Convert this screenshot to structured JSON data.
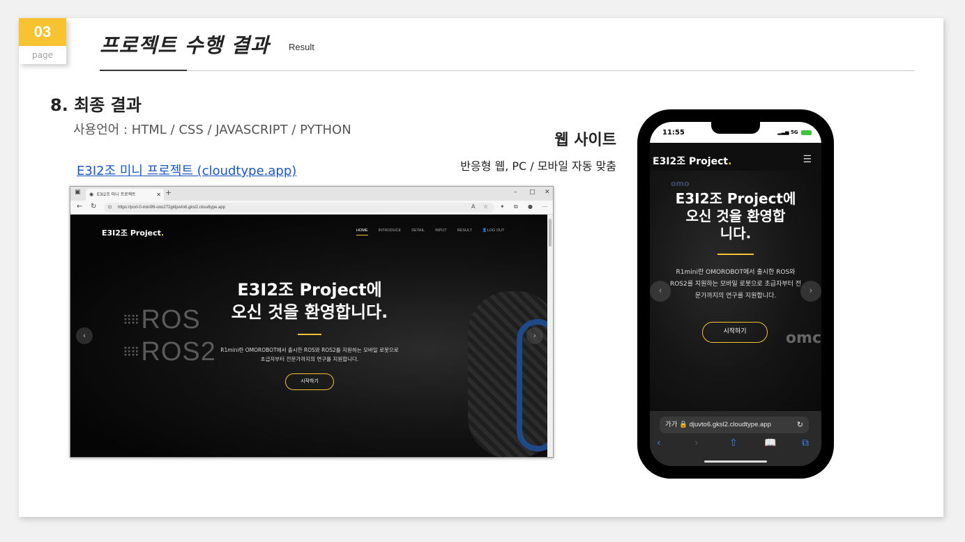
{
  "badge": {
    "number": "03",
    "label": "page"
  },
  "header": {
    "title": "프로젝트 수행 결과",
    "subtitle": "Result"
  },
  "section": {
    "title": "8. 최종 결과",
    "languages": "사용언어 : HTML / CSS / JAVASCRIPT / PYTHON",
    "link": "E3I2조 미니 프로젝트 (cloudtype.app)",
    "web_title": "웹 사이트",
    "web_desc": "반응형 웹, PC / 모바일 자동 맞춤"
  },
  "browser": {
    "tab_title": "E3I2조 미니 프로젝트",
    "url": "https://port-0-mini99-ooo272gldjuvto6.gksl2.cloudtype.app",
    "controls": [
      "–",
      "□",
      "✕"
    ]
  },
  "desktop_site": {
    "logo": "E3I2조 Project",
    "logo_dot": ".",
    "nav": [
      "HOME",
      "INTRODUCE",
      "DETAIL",
      "INPUT",
      "RESULT",
      "LOG OUT"
    ],
    "bg_text_1": "ROS",
    "bg_text_2": "ROS2",
    "hero_line1": "E3I2조 Project에",
    "hero_line2": "오신 것을 환영합니다.",
    "hero_text_1": "R1mini란 OMOROBOT에서 출시한 ROS와 ROS2를 지원하는 모바일 로봇으로",
    "hero_text_2": "초급자부터 전문가까지의 연구를 지원합니다.",
    "button": "시작하기"
  },
  "mobile": {
    "time": "11:55",
    "network": "5G",
    "logo": "E3I2조 Project",
    "logo_dot": ".",
    "omo_label": "omo",
    "omo_label2": "omc",
    "hero_line1": "E3I2조 Project에",
    "hero_line2": "오신 것을 환영합",
    "hero_line3": "니다.",
    "hero_text": "R1mini란 OMOROBOT에서 출시한 ROS와 ROS2를 지원하는 모바일 로봇으로 초급자부터 전문가까지의 연구를 지원합니다.",
    "button": "시작하기",
    "url_prefix": "가가",
    "url": "djuvto6.gksl2.cloudtype.app"
  },
  "colors": {
    "accent": "#f7c331",
    "link": "#1a56c6",
    "mobile_blue": "#3b82f6"
  }
}
